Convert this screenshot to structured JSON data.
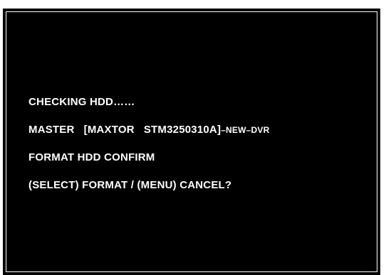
{
  "dvr_screen": {
    "status_line": "CHECKING HDD……",
    "master_label": "MASTER   [MAXTOR   STM3250310A]",
    "master_suffix": "–NEW–DVR",
    "confirm_line": "FORMAT HDD CONFIRM",
    "prompt_line": "(SELECT) FORMAT / (MENU) CANCEL?"
  },
  "colors": {
    "screen_background": "#000000",
    "text": "#ffffff"
  }
}
